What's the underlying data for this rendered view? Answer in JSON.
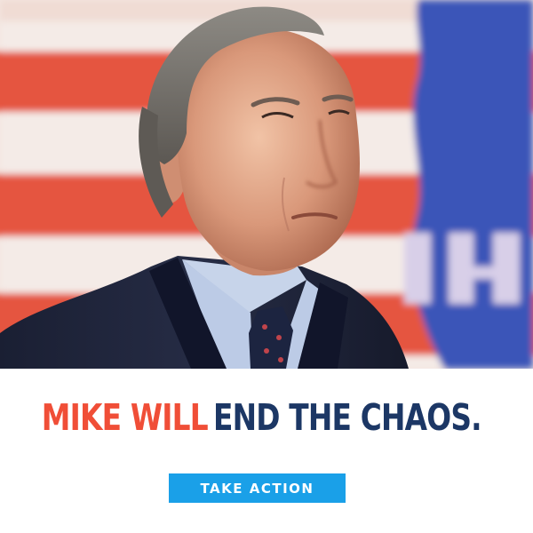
{
  "colors": {
    "headline_red": "#f04e37",
    "headline_navy": "#1c3765",
    "button_blue": "#1aa0e8",
    "button_text": "#ffffff",
    "flag_red": "#e5553f",
    "flag_white": "#f4ebe7",
    "flag_blue": "#3a54b8"
  },
  "headline": {
    "part1": "MIKE WILL",
    "part2": "END THE CHAOS."
  },
  "cta": {
    "label": "TAKE ACTION"
  },
  "icons": {
    "photo": "portrait-photo-with-flag-background"
  }
}
